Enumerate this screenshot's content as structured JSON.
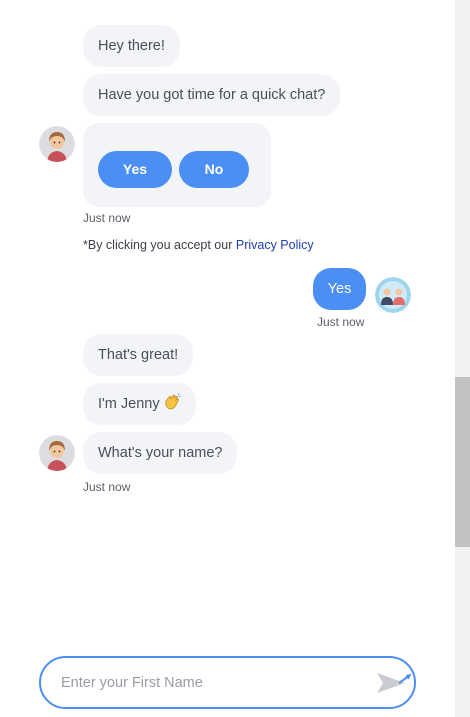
{
  "chat": {
    "bot_messages_1": [
      "Hey there!",
      "Have you got time for a quick chat?"
    ],
    "options": {
      "yes": "Yes",
      "no": "No"
    },
    "timestamp_1": "Just now",
    "privacy_prefix": "*By clicking you accept our ",
    "privacy_link": "Privacy Policy",
    "user_reply": "Yes",
    "timestamp_user": "Just now",
    "bot_messages_2": [
      "That's great!",
      "I'm Jenny",
      "What's your name?"
    ],
    "timestamp_2": "Just now"
  },
  "input": {
    "placeholder": "Enter your First Name",
    "value": ""
  },
  "icons": {
    "bot_avatar": "agent-avatar-icon",
    "user_avatar": "user-avatar-icon",
    "wave": "waving-hand-icon",
    "send": "send-icon"
  },
  "colors": {
    "accent": "#4b8ff5",
    "bot_bubble": "#f3f4f8",
    "link": "#1d3fb0"
  }
}
